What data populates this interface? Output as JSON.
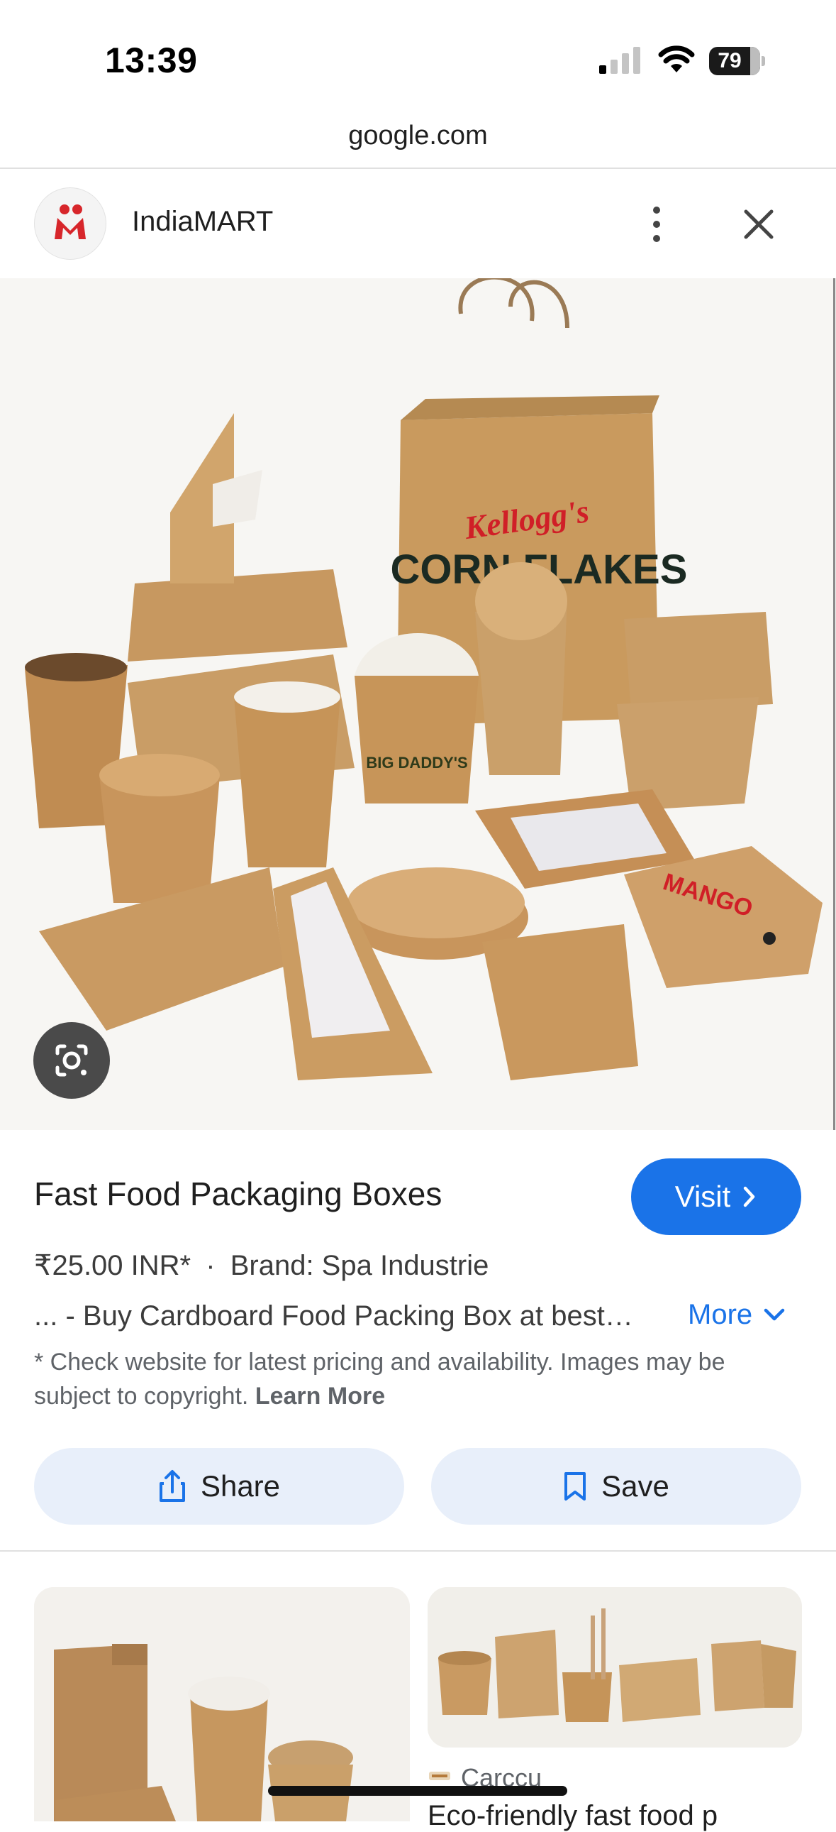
{
  "status_bar": {
    "time": "13:39",
    "battery": "79"
  },
  "browser": {
    "url": "google.com"
  },
  "header": {
    "source": "IndiaMART"
  },
  "result": {
    "title": "Fast Food Packaging Boxes",
    "visit_label": "Visit",
    "price": "₹25.00 INR*",
    "separator": "·",
    "brand": "Brand: Spa Industrie",
    "description": "... - Buy Cardboard Food Packing Box at best…",
    "more_label": "More",
    "disclaimer": "* Check website for latest pricing and availability. Images may be subject to copyright.",
    "learn_more": "Learn More",
    "share_label": "Share",
    "save_label": "Save"
  },
  "image_text": {
    "bag_brand": "Kellogg's",
    "bag_product": "CORN FLAKES",
    "fries": "BIG DADDY'S",
    "burger_box": "MANGO"
  },
  "related": {
    "card2_source": "Carccu",
    "card2_title": "Eco-friendly fast food p"
  },
  "colors": {
    "accent": "#1a73e8",
    "button_bg": "#e8effa",
    "kraft": "#c99a5e"
  }
}
